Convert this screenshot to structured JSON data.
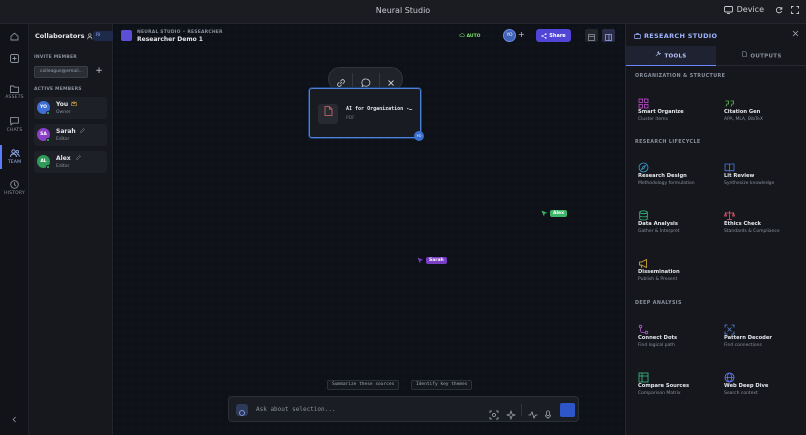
{
  "topbar": {
    "title": "Neural Studio",
    "device_label": "Device"
  },
  "rail": {
    "items": [
      {
        "label": "ASSETS"
      },
      {
        "label": "CHATS"
      },
      {
        "label": "TEAM"
      },
      {
        "label": "HISTORY"
      }
    ]
  },
  "collab": {
    "title": "Collaborators",
    "badge": "RI",
    "invite_label": "INVITE MEMBER",
    "invite_placeholder": "colleague@email...",
    "active_label": "ACTIVE MEMBERS",
    "members": [
      {
        "initials": "YO",
        "name": "You",
        "role": "Owner",
        "color": "#3e6fd6"
      },
      {
        "initials": "SA",
        "name": "Sarah",
        "role": "Editor",
        "color": "#8a3fc9"
      },
      {
        "initials": "AL",
        "name": "Alex",
        "role": "Editor",
        "color": "#2f9a5a"
      }
    ]
  },
  "canvas": {
    "crumb_app": "NEURAL STUDIO",
    "crumb_mode": "RESEARCHER",
    "project_title": "Researcher Demo 1",
    "auto_label": "AUTO",
    "user_initials": "YO",
    "share_label": "Share",
    "node": {
      "title": "AI for Organization -…",
      "type": "PDF",
      "badge": "YO"
    },
    "cursors": [
      {
        "name": "Alex",
        "color": "#3fb56a"
      },
      {
        "name": "Sarah",
        "color": "#7a3fc4"
      }
    ],
    "suggestions": [
      "Summarize these sources",
      "Identify key themes"
    ],
    "chat_placeholder": "Ask about selection..."
  },
  "studio": {
    "title": "RESEARCH STUDIO",
    "tabs": [
      {
        "label": "TOOLS"
      },
      {
        "label": "OUTPUTS"
      }
    ],
    "categories": [
      {
        "label": "ORGANIZATION & STRUCTURE"
      },
      {
        "label": "RESEARCH LIFECYCLE"
      },
      {
        "label": "DEEP ANALYSIS"
      }
    ],
    "tools": [
      {
        "name": "Smart Organize",
        "desc": "Cluster items",
        "icon": "grid-icon",
        "color": "#c04fd0"
      },
      {
        "name": "Citation Gen",
        "desc": "APA, MLA, BibTeX",
        "icon": "quote-icon",
        "color": "#57c24e"
      },
      {
        "name": "Research Design",
        "desc": "Methodology formulation",
        "icon": "compass-icon",
        "color": "#3aa7d6"
      },
      {
        "name": "Lit Review",
        "desc": "Synthesize knowledge",
        "icon": "book-icon",
        "color": "#4f7ce0"
      },
      {
        "name": "Data Analysis",
        "desc": "Gather & Interpret",
        "icon": "database-icon",
        "color": "#3cc08a"
      },
      {
        "name": "Ethics Check",
        "desc": "Standards & Compliance",
        "icon": "scale-icon",
        "color": "#e25a6b"
      },
      {
        "name": "Dissemination",
        "desc": "Publish & Present",
        "icon": "megaphone-icon",
        "color": "#e0b23a"
      },
      {
        "name": "Connect Dots",
        "desc": "Find logical path",
        "icon": "path-icon",
        "color": "#b25ad0"
      },
      {
        "name": "Pattern Decoder",
        "desc": "Find connections",
        "icon": "scan-icon",
        "color": "#5a8be0"
      },
      {
        "name": "Compare Sources",
        "desc": "Comparison Matrix",
        "icon": "table-icon",
        "color": "#3cc08a"
      },
      {
        "name": "Web Deep Dive",
        "desc": "Search context",
        "icon": "globe-icon",
        "color": "#6b86ff"
      }
    ]
  }
}
